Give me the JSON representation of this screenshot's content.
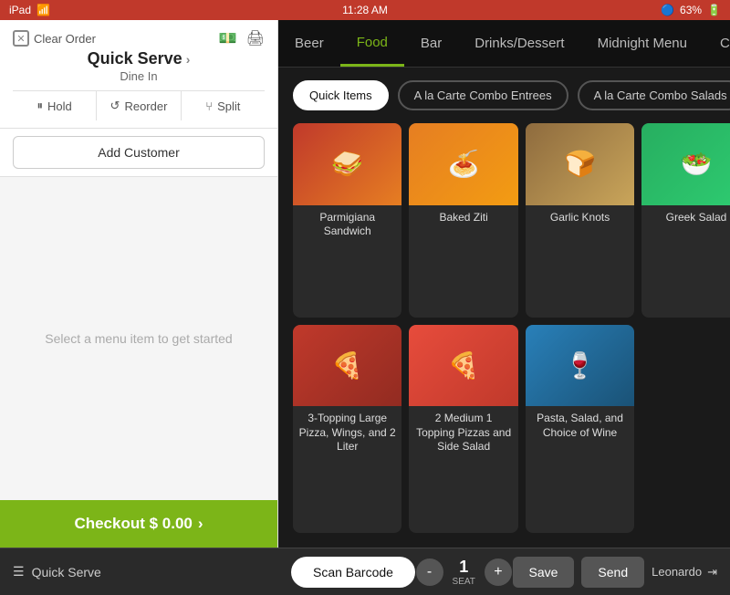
{
  "statusBar": {
    "time": "11:28 AM",
    "wifi": "iPad",
    "bluetooth": "63%"
  },
  "leftPanel": {
    "clearOrderLabel": "Clear Order",
    "title": "Quick Serve",
    "titleArrow": "›",
    "subTitle": "Dine In",
    "holdLabel": "Hold",
    "reorderLabel": "Reorder",
    "splitLabel": "Split",
    "addCustomerLabel": "Add Customer",
    "emptyMessage": "Select a menu item to get started",
    "checkoutLabel": "Checkout $ 0.00",
    "checkoutArrow": "›"
  },
  "rightPanel": {
    "navTabs": [
      {
        "label": "Beer",
        "active": false
      },
      {
        "label": "Food",
        "active": true
      },
      {
        "label": "Bar",
        "active": false
      },
      {
        "label": "Drinks/Dessert",
        "active": false
      },
      {
        "label": "Midnight Menu",
        "active": false
      },
      {
        "label": "Co...",
        "active": false
      }
    ],
    "menuTabs": [
      {
        "label": "Quick Items",
        "active": true
      },
      {
        "label": "A la Carte Combo Entrees",
        "active": false
      },
      {
        "label": "A la Carte Combo Salads",
        "active": false
      }
    ],
    "foodItems": [
      {
        "name": "Parmigiana Sandwich",
        "imgClass": "img-parmigiana",
        "emoji": "🥪"
      },
      {
        "name": "Baked Ziti",
        "imgClass": "img-baked-ziti",
        "emoji": "🍝"
      },
      {
        "name": "Garlic Knots",
        "imgClass": "img-garlic-knots",
        "emoji": "🍞"
      },
      {
        "name": "Greek Salad",
        "imgClass": "img-greek-salad",
        "emoji": "🥗"
      },
      {
        "name": "3-Topping Large Pizza, Wings, and 2 Liter",
        "imgClass": "img-pizza-wings",
        "emoji": "🍕"
      },
      {
        "name": "2 Medium 1 Topping Pizzas and Side Salad",
        "imgClass": "img-two-pizzas",
        "emoji": "🍕"
      },
      {
        "name": "Pasta, Salad, and Choice of Wine",
        "imgClass": "img-pasta",
        "emoji": "🍷"
      }
    ]
  },
  "bottomBar": {
    "menuLabel": "Quick Serve",
    "scanBarcodeLabel": "Scan Barcode",
    "minusLabel": "-",
    "seatNumber": "1",
    "seatLabel": "SEAT",
    "plusLabel": "+",
    "saveLabel": "Save",
    "sendLabel": "Send",
    "userLabel": "Leonardo"
  }
}
